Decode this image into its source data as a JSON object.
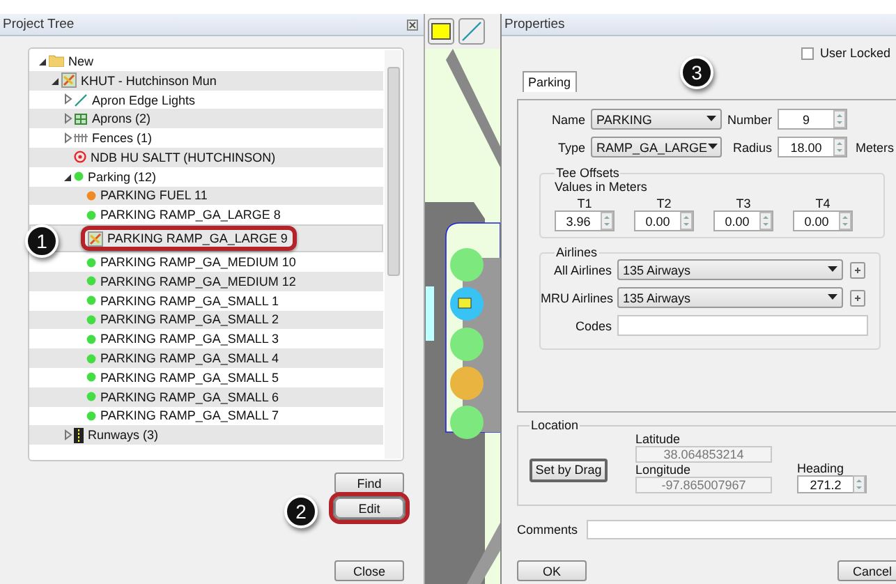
{
  "project_tree": {
    "title": "Project Tree",
    "tree": [
      {
        "label": "New",
        "kind": "folder",
        "expanded": true,
        "selected": false,
        "highlighted": false,
        "children": [
          {
            "label": "KHUT - Hutchinson Mun",
            "kind": "airport",
            "expanded": true,
            "selected": false,
            "highlighted": false,
            "children": [
              {
                "label": "Apron Edge Lights",
                "kind": "line",
                "expanded": false,
                "selected": false,
                "highlighted": false
              },
              {
                "label": "Aprons (2)",
                "kind": "apron",
                "expanded": false,
                "selected": false,
                "highlighted": false
              },
              {
                "label": "Fences (1)",
                "kind": "fence",
                "expanded": false,
                "selected": false,
                "highlighted": false
              },
              {
                "label": "NDB HU SALTT (HUTCHINSON)",
                "kind": "ndb",
                "selected": false,
                "highlighted": false
              },
              {
                "label": "Parking (12)",
                "kind": "dot",
                "color": "#44dd44",
                "expanded": true,
                "selected": false,
                "highlighted": false,
                "children": [
                  {
                    "label": "PARKING FUEL 11",
                    "kind": "dot",
                    "color": "#f08a24",
                    "selected": false,
                    "highlighted": false
                  },
                  {
                    "label": "PARKING RAMP_GA_LARGE 8",
                    "kind": "dot",
                    "color": "#44dd44",
                    "selected": false,
                    "highlighted": false
                  },
                  {
                    "label": "PARKING RAMP_GA_LARGE 9",
                    "kind": "airport",
                    "selected": true,
                    "highlighted": true
                  },
                  {
                    "label": "PARKING RAMP_GA_MEDIUM 10",
                    "kind": "dot",
                    "color": "#44dd44",
                    "selected": false,
                    "highlighted": false
                  },
                  {
                    "label": "PARKING RAMP_GA_MEDIUM 12",
                    "kind": "dot",
                    "color": "#44dd44",
                    "selected": false,
                    "highlighted": false
                  },
                  {
                    "label": "PARKING RAMP_GA_SMALL 1",
                    "kind": "dot",
                    "color": "#44dd44",
                    "selected": false,
                    "highlighted": false
                  },
                  {
                    "label": "PARKING RAMP_GA_SMALL 2",
                    "kind": "dot",
                    "color": "#44dd44",
                    "selected": false,
                    "highlighted": false
                  },
                  {
                    "label": "PARKING RAMP_GA_SMALL 3",
                    "kind": "dot",
                    "color": "#44dd44",
                    "selected": false,
                    "highlighted": false
                  },
                  {
                    "label": "PARKING RAMP_GA_SMALL 4",
                    "kind": "dot",
                    "color": "#44dd44",
                    "selected": false,
                    "highlighted": false
                  },
                  {
                    "label": "PARKING RAMP_GA_SMALL 5",
                    "kind": "dot",
                    "color": "#44dd44",
                    "selected": false,
                    "highlighted": false
                  },
                  {
                    "label": "PARKING RAMP_GA_SMALL 6",
                    "kind": "dot",
                    "color": "#44dd44",
                    "selected": false,
                    "highlighted": false
                  },
                  {
                    "label": "PARKING RAMP_GA_SMALL 7",
                    "kind": "dot",
                    "color": "#44dd44",
                    "selected": false,
                    "highlighted": false
                  }
                ]
              },
              {
                "label": "Runways (3)",
                "kind": "runway",
                "expanded": false,
                "selected": false,
                "highlighted": false
              }
            ]
          }
        ]
      }
    ],
    "buttons": [
      {
        "label": "Find",
        "highlighted": false
      },
      {
        "label": "Edit",
        "highlighted": true
      },
      {
        "label": "Close",
        "highlighted": false
      }
    ]
  },
  "properties": {
    "title": "Properties",
    "user_locked": {
      "label": "User Locked",
      "checked": false
    },
    "tab": "Parking",
    "name": {
      "label": "Name",
      "value": "PARKING"
    },
    "number": {
      "label": "Number",
      "value": "9"
    },
    "type": {
      "label": "Type",
      "value": "RAMP_GA_LARGE"
    },
    "radius": {
      "label": "Radius",
      "value": "18.00",
      "unit": "Meters"
    },
    "tee_offsets": {
      "title": "Tee Offsets",
      "subtitle": "Values in Meters",
      "offsets": [
        {
          "label": "T1",
          "value": "3.96"
        },
        {
          "label": "T2",
          "value": "0.00"
        },
        {
          "label": "T3",
          "value": "0.00"
        },
        {
          "label": "T4",
          "value": "0.00"
        }
      ]
    },
    "airlines": {
      "title": "Airlines",
      "all_airlines": {
        "label": "All Airlines",
        "value": "135 Airways"
      },
      "mru_airlines": {
        "label": "MRU Airlines",
        "value": "135 Airways"
      },
      "codes": {
        "label": "Codes"
      }
    },
    "location": {
      "title": "Location",
      "set_button": "Set by Drag",
      "latitude": {
        "label": "Latitude",
        "value": "38.064853214"
      },
      "longitude": {
        "label": "Longitude",
        "value": "-97.865007967"
      },
      "heading": {
        "label": "Heading",
        "value": "271.2"
      }
    },
    "comments": {
      "label": "Comments"
    },
    "buttons": [
      "OK",
      "Cancel"
    ]
  },
  "callouts": [
    "1",
    "2",
    "3"
  ]
}
